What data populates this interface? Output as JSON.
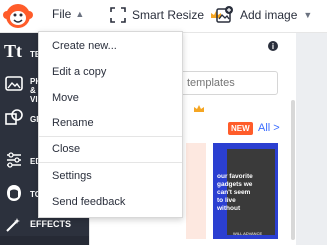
{
  "topbar": {
    "file_label": "File",
    "smart_resize_label": "Smart Resize",
    "add_image_label": "Add image"
  },
  "sidebar": {
    "items": [
      {
        "label": "TEXT",
        "icon": "text-tt-icon"
      },
      {
        "label": "PHOTOS & VIDEOS",
        "icon": "photo-icon"
      },
      {
        "label": "GRAPHICS",
        "icon": "shapes-icon"
      },
      {
        "label": "EDIT",
        "icon": "sliders-icon"
      },
      {
        "label": "TOUCH UP",
        "icon": "face-icon"
      }
    ],
    "effects_label": "EFFECTS"
  },
  "file_menu": {
    "items": [
      "Create new...",
      "Edit a copy",
      "Move",
      "Rename",
      "Close",
      "Settings",
      "Send feedback"
    ]
  },
  "templates": {
    "search_placeholder": "templates",
    "new_badge": "NEW",
    "all_link": "All >",
    "card_text": "our favorite gadgets we can't seem to live without",
    "card_caption": "WILL ADVANCE",
    "info_icon": "i"
  },
  "colors": {
    "sidebar_bg": "#2c313d",
    "accent_orange": "#ff5c2a",
    "link_blue": "#3b6dff",
    "card_blue": "#2b3fd1",
    "crown_gold": "#f5a623"
  }
}
